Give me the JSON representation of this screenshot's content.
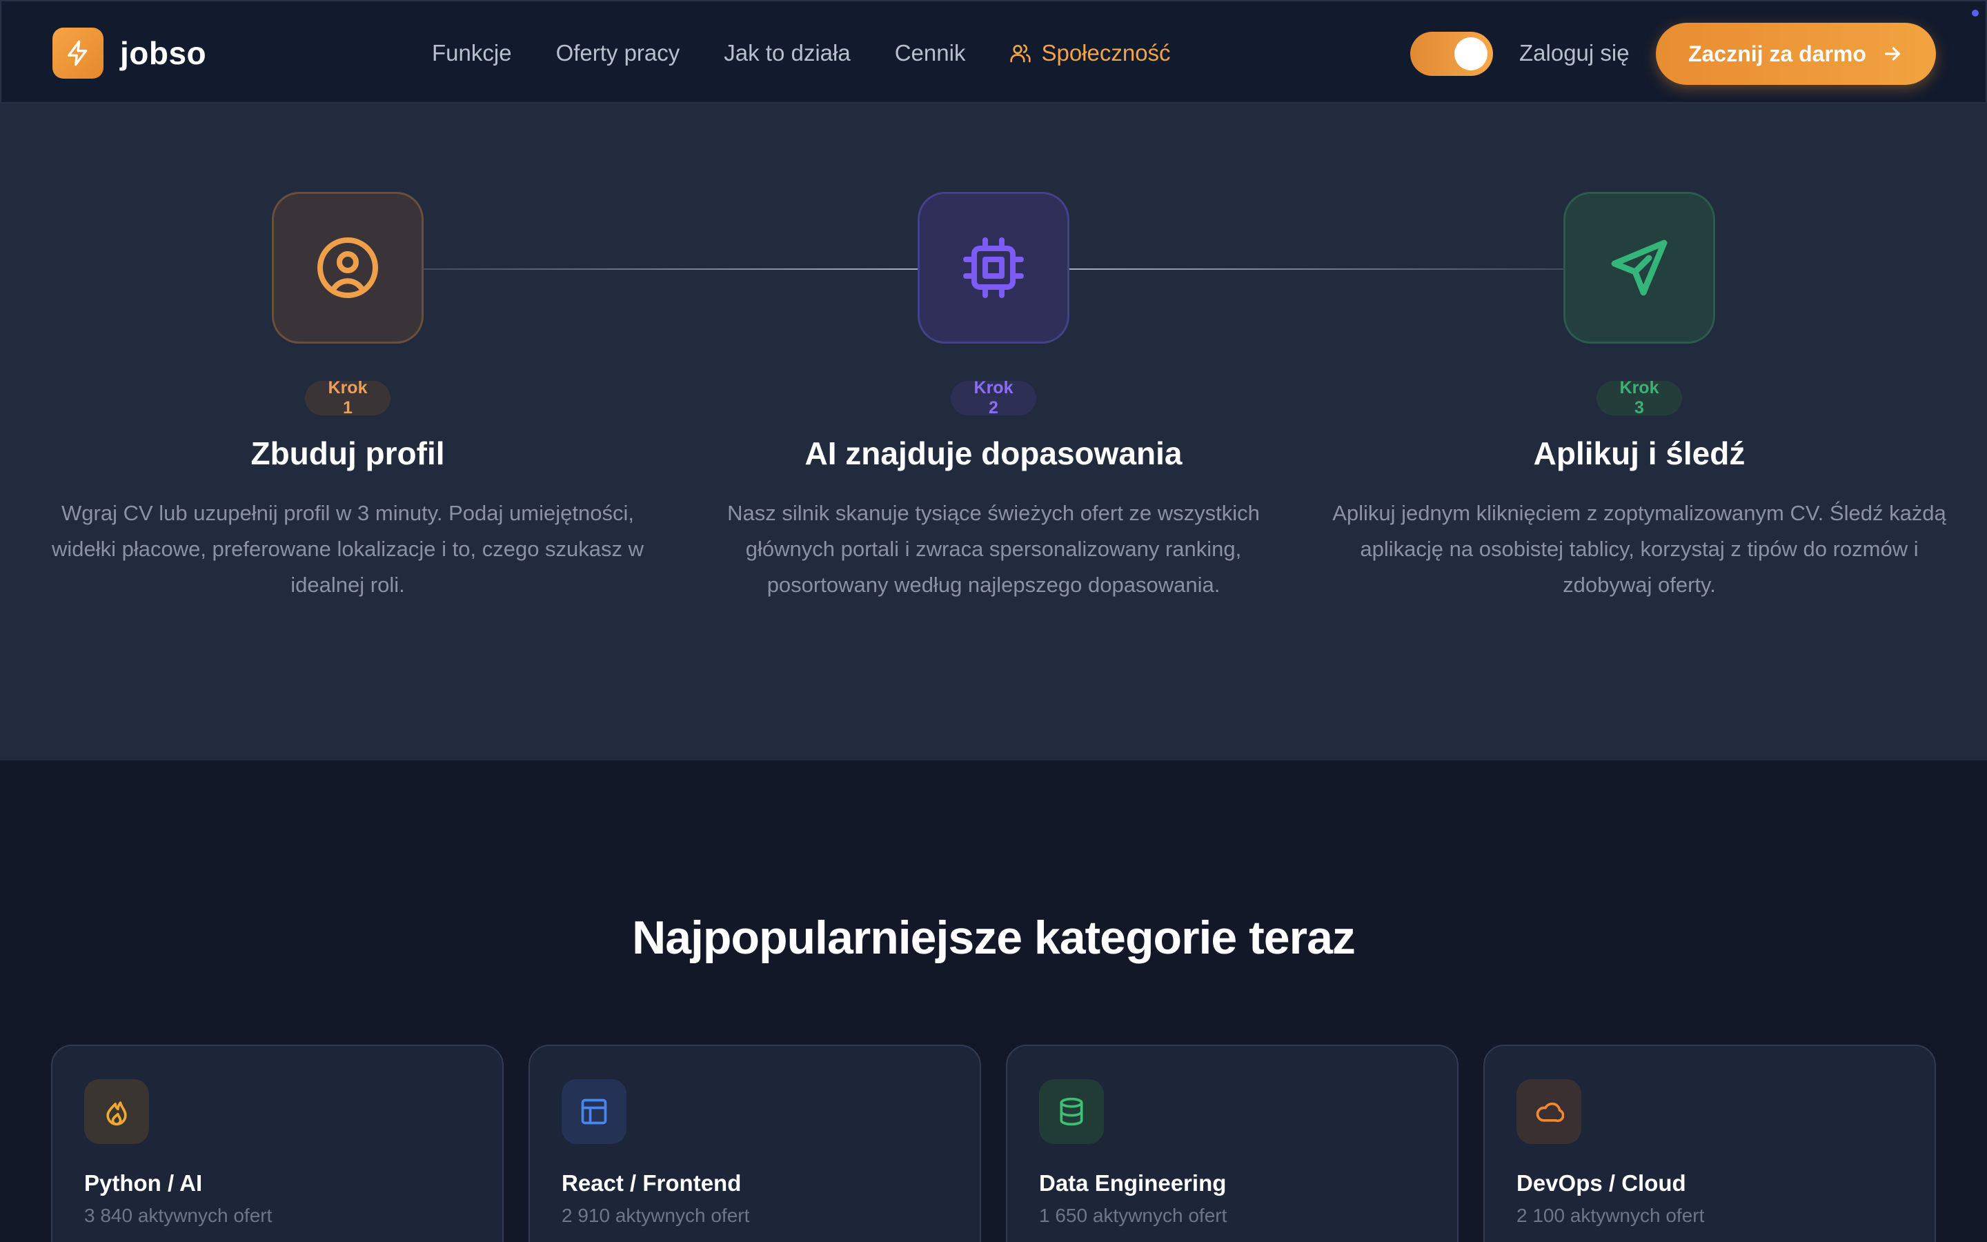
{
  "header": {
    "logo_text": "jobso",
    "nav": [
      {
        "label": "Funkcje"
      },
      {
        "label": "Oferty pracy"
      },
      {
        "label": "Jak to działa"
      },
      {
        "label": "Cennik"
      },
      {
        "label": "Społeczność",
        "active": true
      }
    ],
    "theme_toggle_on": true,
    "login_label": "Zaloguj się",
    "cta_label": "Zacznij za darmo"
  },
  "steps": [
    {
      "badge": "Krok 1",
      "title": "Zbuduj profil",
      "description": "Wgraj CV lub uzupełnij profil w 3 minuty. Podaj umiejętności, widełki płacowe, preferowane lokalizacje i to, czego szukasz w idealnej roli.",
      "icon": "user-circle-icon",
      "color": "#f0a04b"
    },
    {
      "badge": "Krok 2",
      "title": "AI znajduje dopasowania",
      "description": "Nasz silnik skanuje tysiące świeżych ofert ze wszystkich głównych portali i zwraca spersonalizowany ranking, posortowany według najlepszego dopasowania.",
      "icon": "cpu-chip-icon",
      "color": "#7c5cf5"
    },
    {
      "badge": "Krok 3",
      "title": "Aplikuj i śledź",
      "description": "Aplikuj jednym kliknięciem z zoptymalizowanym CV. Śledź każdą aplikację na osobistej tablicy, korzystaj z tipów do rozmów i zdobywaj oferty.",
      "icon": "send-icon",
      "color": "#34b57a"
    }
  ],
  "categories_title": "Najpopularniejsze kategorie teraz",
  "categories": [
    {
      "title": "Python / AI",
      "count": "3 840 aktywnych ofert",
      "icon": "flame-icon",
      "color": "#f0a832"
    },
    {
      "title": "React / Frontend",
      "count": "2 910 aktywnych ofert",
      "icon": "layout-icon",
      "color": "#4a86f0"
    },
    {
      "title": "Data Engineering",
      "count": "1 650 aktywnych ofert",
      "icon": "database-icon",
      "color": "#3fbf73"
    },
    {
      "title": "DevOps / Cloud",
      "count": "2 100 aktywnych ofert",
      "icon": "cloud-icon",
      "color": "#f08a32"
    }
  ],
  "colors": {
    "accent": "#f0a04b",
    "background": "#121828",
    "section": "#222a3d"
  }
}
